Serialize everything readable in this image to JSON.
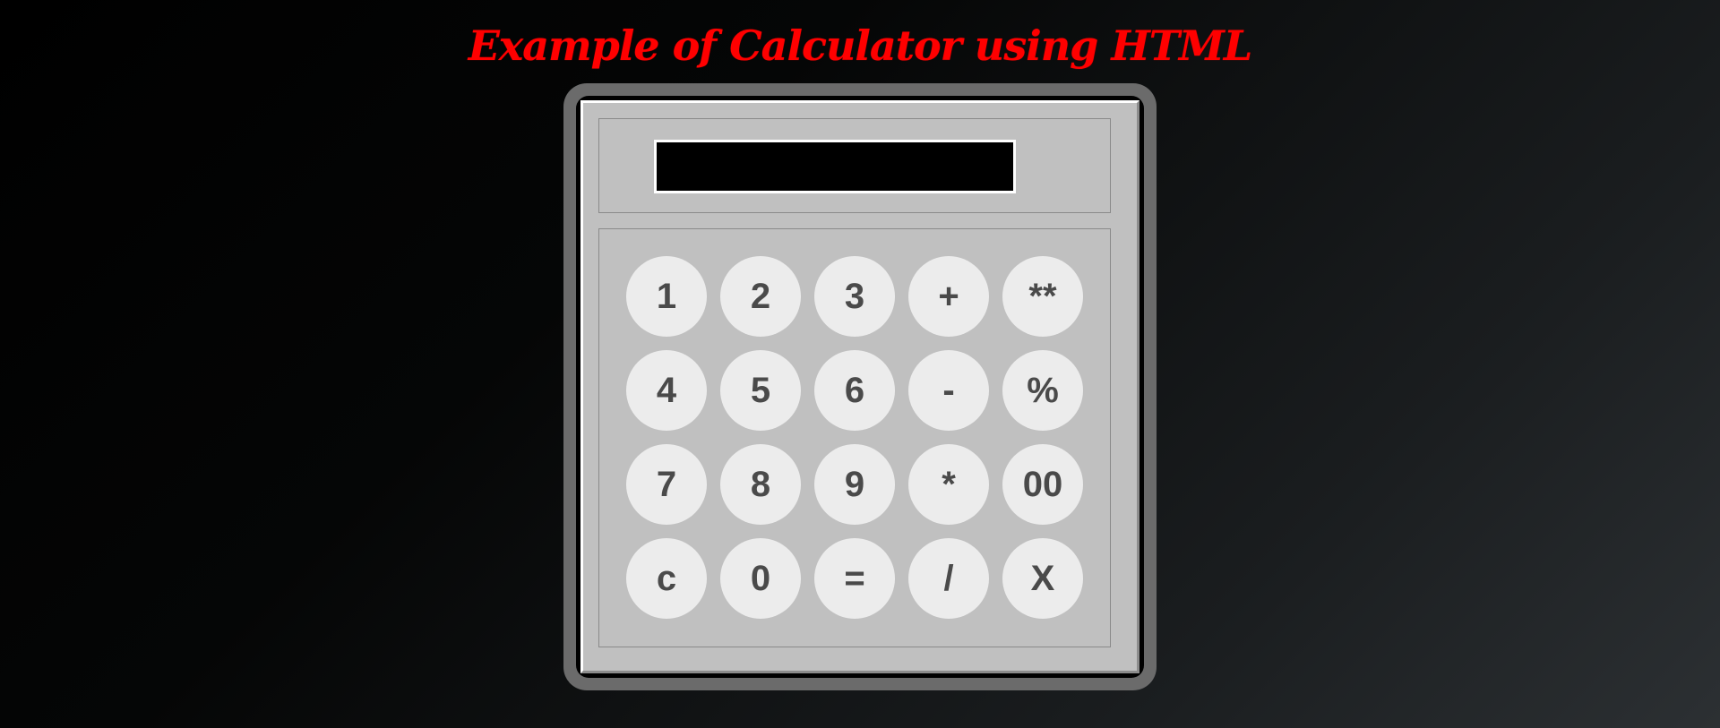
{
  "page": {
    "title": "Example of Calculator using HTML"
  },
  "display": {
    "value": ""
  },
  "keys": [
    {
      "label": "1",
      "name": "key-1"
    },
    {
      "label": "2",
      "name": "key-2"
    },
    {
      "label": "3",
      "name": "key-3"
    },
    {
      "label": "+",
      "name": "key-plus"
    },
    {
      "label": "**",
      "name": "key-power"
    },
    {
      "label": "4",
      "name": "key-4"
    },
    {
      "label": "5",
      "name": "key-5"
    },
    {
      "label": "6",
      "name": "key-6"
    },
    {
      "label": "-",
      "name": "key-minus"
    },
    {
      "label": "%",
      "name": "key-percent"
    },
    {
      "label": "7",
      "name": "key-7"
    },
    {
      "label": "8",
      "name": "key-8"
    },
    {
      "label": "9",
      "name": "key-9"
    },
    {
      "label": "*",
      "name": "key-multiply"
    },
    {
      "label": "00",
      "name": "key-double-zero"
    },
    {
      "label": "c",
      "name": "key-clear"
    },
    {
      "label": "0",
      "name": "key-0"
    },
    {
      "label": "=",
      "name": "key-equals"
    },
    {
      "label": "/",
      "name": "key-divide"
    },
    {
      "label": "X",
      "name": "key-backspace"
    }
  ],
  "colors": {
    "title": "#ff0000",
    "frame": "#6b6b6b",
    "body": "#c0c0c0",
    "key": "#ececec",
    "key_text": "#4a4a4a",
    "display": "#000000"
  }
}
